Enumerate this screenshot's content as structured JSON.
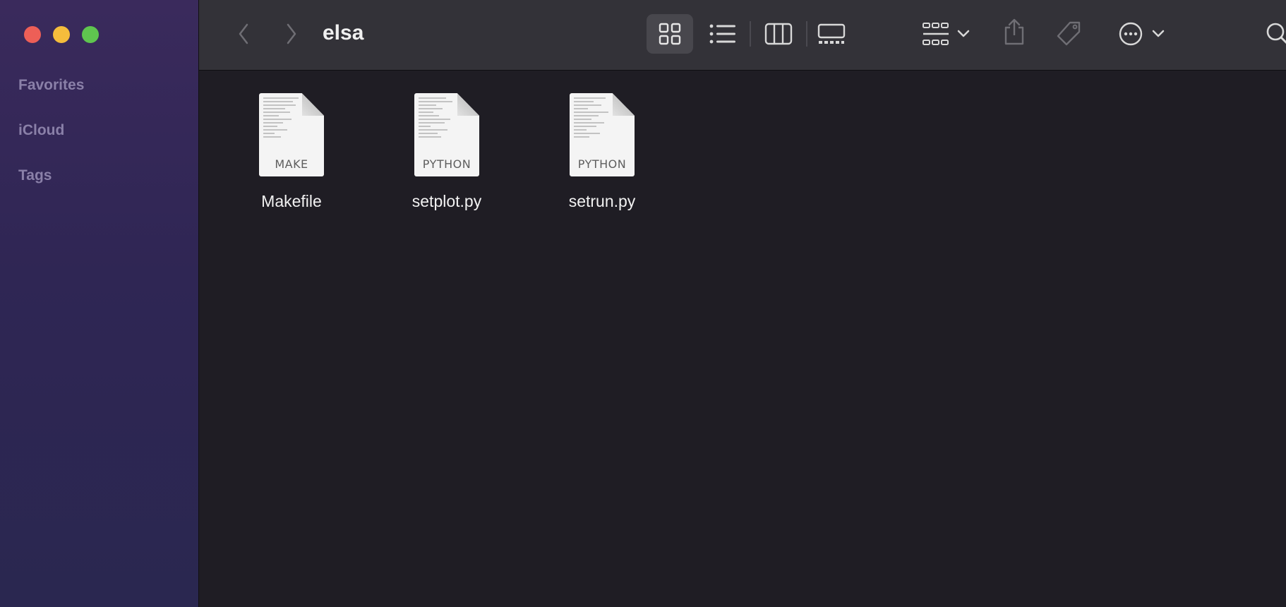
{
  "sidebar": {
    "sections": [
      "Favorites",
      "iCloud",
      "Tags"
    ]
  },
  "toolbar": {
    "title": "elsa",
    "icons": {
      "back": "chevron-left-icon",
      "forward": "chevron-right-icon",
      "icon_view": "grid-icon",
      "list_view": "list-icon",
      "column_view": "columns-icon",
      "gallery_view": "gallery-icon",
      "group": "group-grid-icon",
      "share": "share-icon",
      "tags": "tag-icon",
      "more": "ellipsis-circle-icon",
      "search": "search-icon"
    }
  },
  "files": [
    {
      "name": "Makefile",
      "kind": "MAKE"
    },
    {
      "name": "setplot.py",
      "kind": "PYTHON"
    },
    {
      "name": "setrun.py",
      "kind": "PYTHON"
    }
  ],
  "colors": {
    "close": "#ed5f57",
    "minimize": "#f5bd3c",
    "zoom": "#5fc54f",
    "sidebar_top": "#3a2a5c",
    "content_bg": "#1f1d24",
    "toolbar_bg": "#333238"
  }
}
